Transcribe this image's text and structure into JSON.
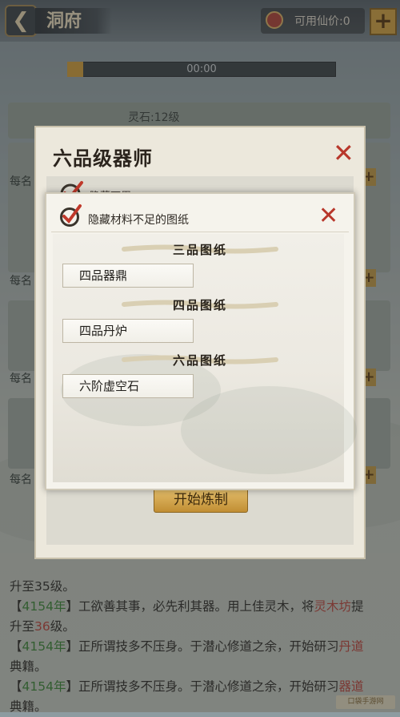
{
  "header": {
    "title": "洞府",
    "currency_label": "可用仙价:0",
    "plus": "+"
  },
  "timer": {
    "text": "00:00",
    "progress": 0.06
  },
  "background": {
    "stone_label": "灵石:12级",
    "side_each": [
      "每名",
      "每名",
      "每名",
      "每名"
    ],
    "log_lines": [
      [
        {
          "t": "升至35级。",
          "c": "n"
        }
      ],
      [
        {
          "t": "【",
          "c": "n"
        },
        {
          "t": "4154年",
          "c": "y"
        },
        {
          "t": "】工欲善其事，必先利其器。用上佳灵木，将",
          "c": "n"
        },
        {
          "t": "灵木坊",
          "c": "r"
        },
        {
          "t": "提",
          "c": "n"
        }
      ],
      [
        {
          "t": "升至",
          "c": "n"
        },
        {
          "t": "36",
          "c": "r"
        },
        {
          "t": "级。",
          "c": "n"
        }
      ],
      [
        {
          "t": "【",
          "c": "n"
        },
        {
          "t": "4154年",
          "c": "y"
        },
        {
          "t": "】正所谓技多不压身。于潜心修道之余，开始研习",
          "c": "n"
        },
        {
          "t": "丹道",
          "c": "r"
        }
      ],
      [
        {
          "t": "典籍。",
          "c": "n"
        }
      ],
      [
        {
          "t": "【",
          "c": "n"
        },
        {
          "t": "4154年",
          "c": "y"
        },
        {
          "t": "】正所谓技多不压身。于潜心修道之余，开始研习",
          "c": "n"
        },
        {
          "t": "器道",
          "c": "r"
        }
      ],
      [
        {
          "t": "典籍。",
          "c": "n"
        }
      ]
    ],
    "watermark": "口袋手游网"
  },
  "back_dialog": {
    "title": "六品级器师",
    "subtitle": "隐藏可用",
    "start_button": "开始炼制"
  },
  "front_dialog": {
    "title": "隐藏材料不足的图纸",
    "sections": [
      {
        "title": "三品图纸",
        "item": "四品器鼎"
      },
      {
        "title": "四品图纸",
        "item": "四品丹炉"
      },
      {
        "title": "六品图纸",
        "item": "六阶虚空石"
      }
    ]
  },
  "colors": {
    "accent_gold": "#d9a53c",
    "close_red": "#b8372b",
    "year_green": "#3d8a3a",
    "highlight_red": "#c0463d"
  },
  "icons": {
    "back": "chevron-left-icon",
    "close": "close-x-icon",
    "checkbox": "checkmark-icon",
    "currency": "coin-icon"
  }
}
